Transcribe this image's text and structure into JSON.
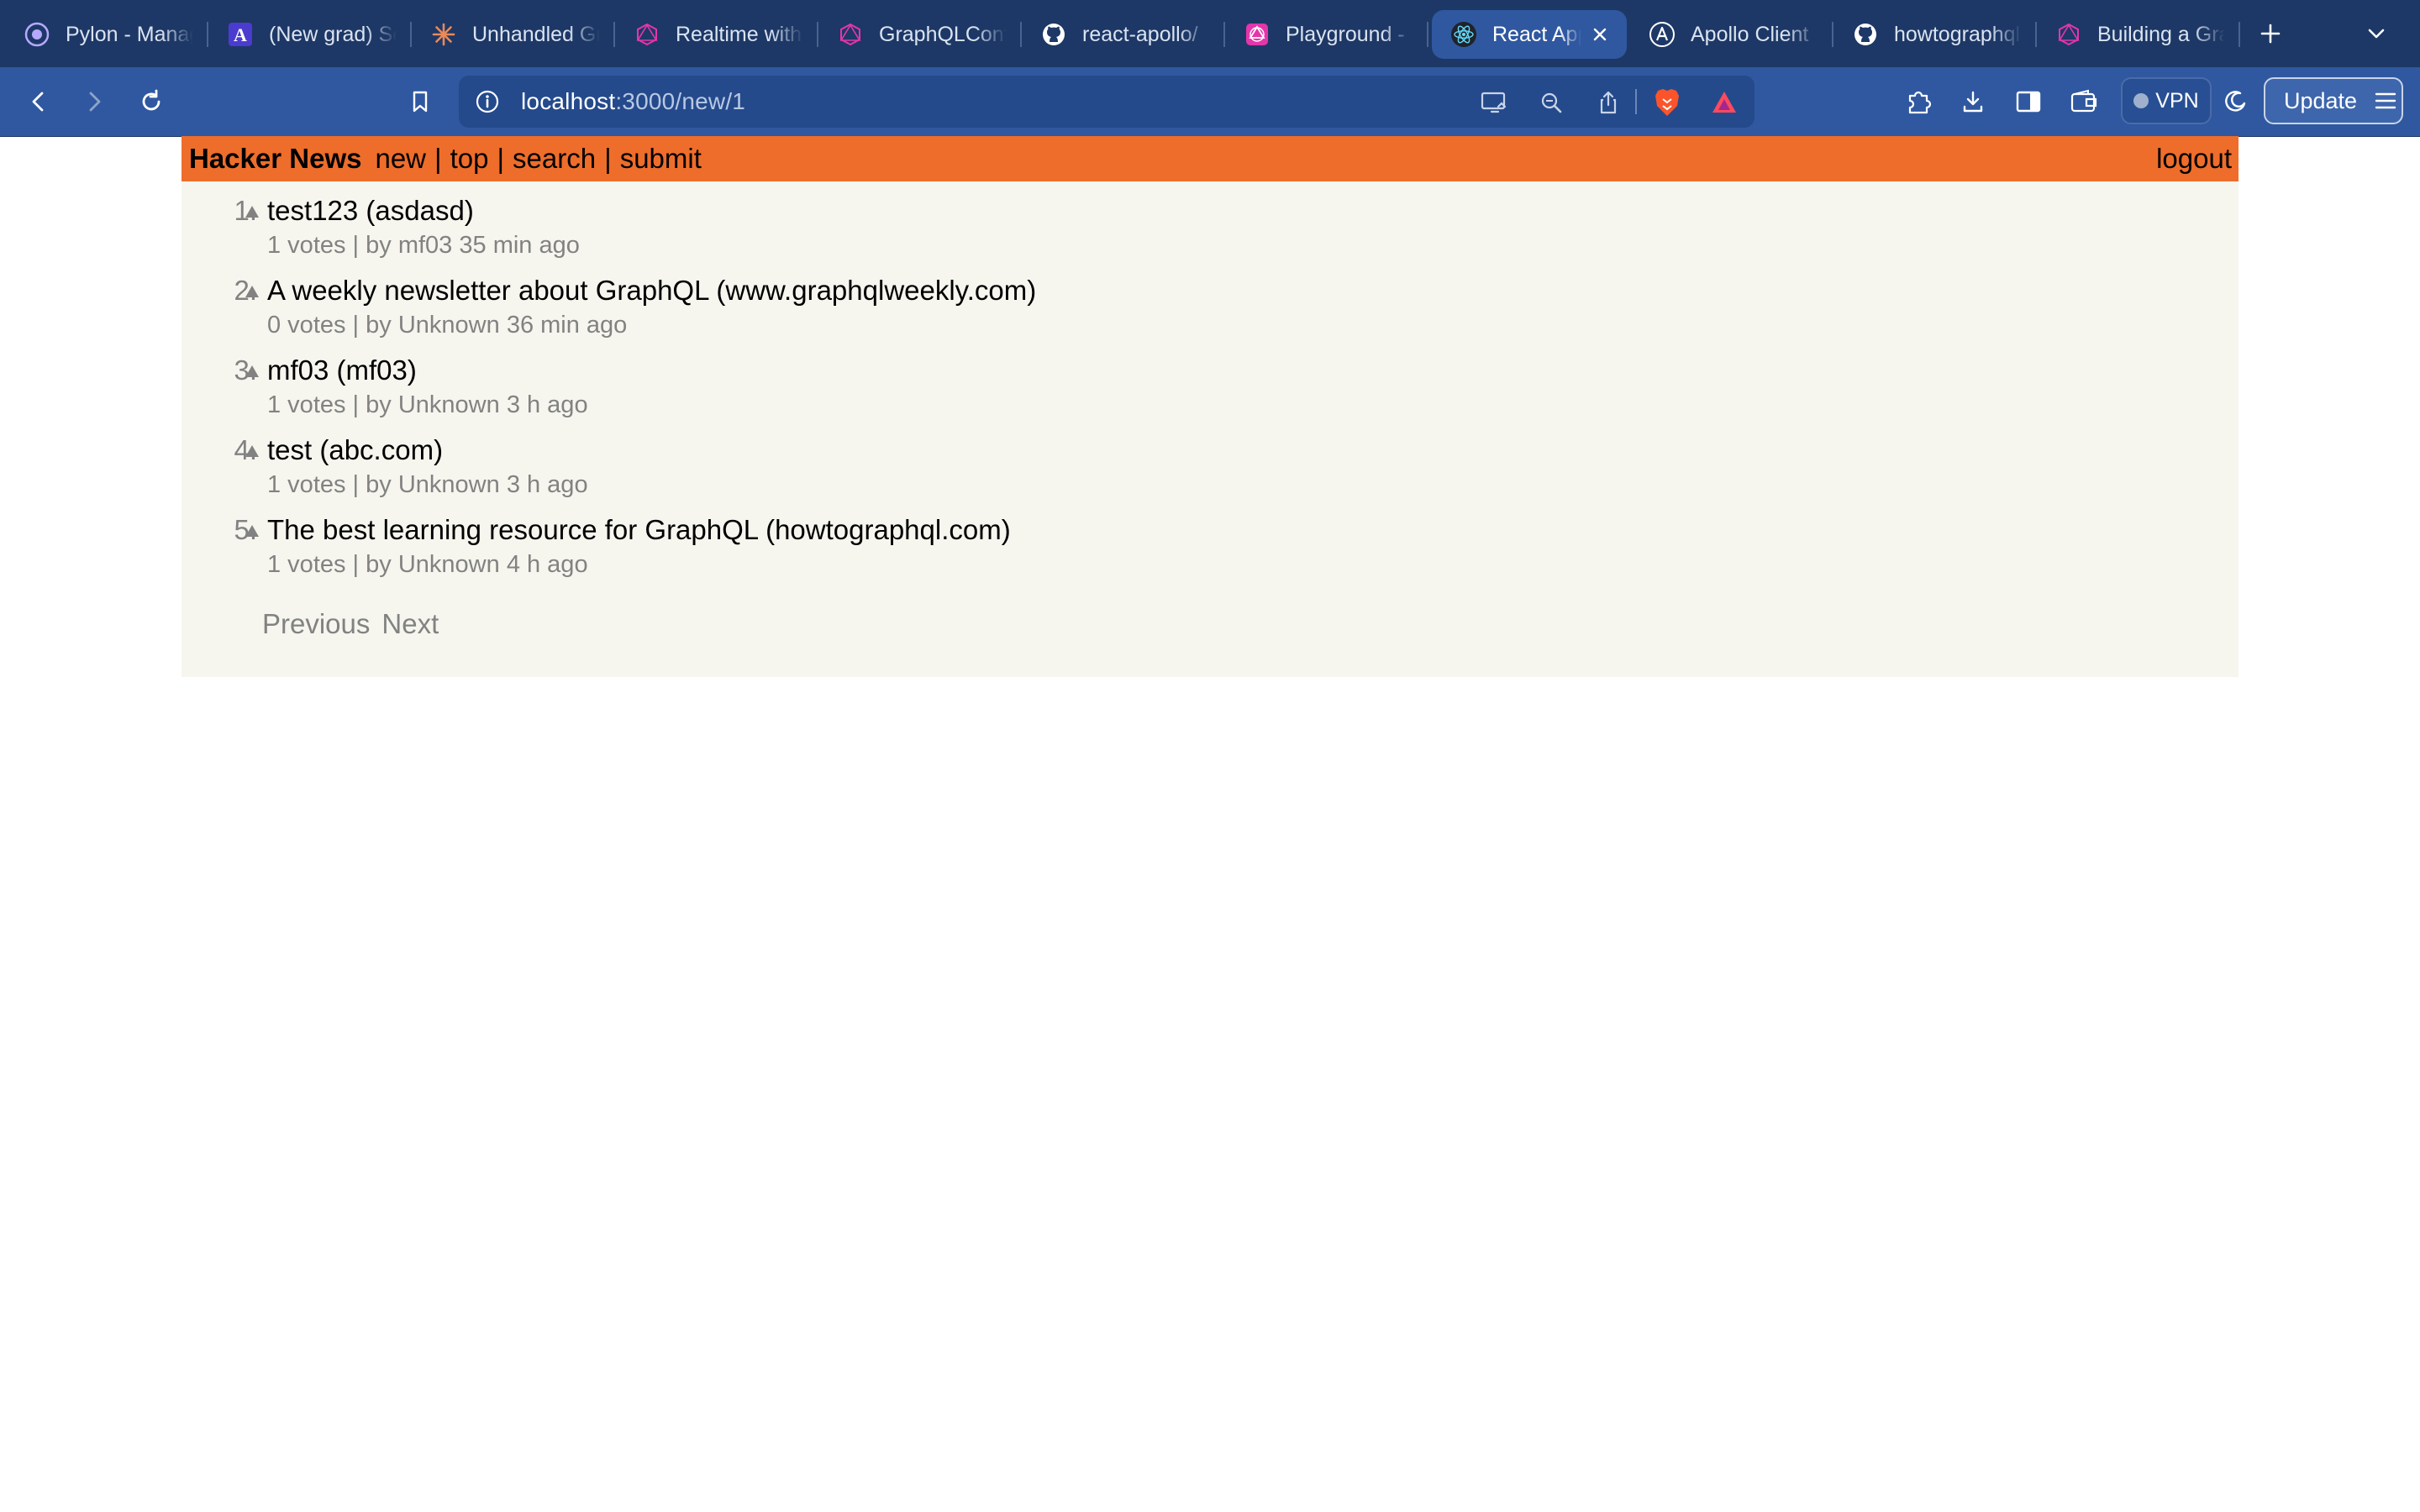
{
  "browser": {
    "tabs": [
      {
        "title": "Pylon - Manage",
        "icon": "pylon-icon",
        "active": false
      },
      {
        "title": "(New grad) Software",
        "icon": "letter-a-icon",
        "active": false
      },
      {
        "title": "Unhandled GraphQL",
        "icon": "burst-icon",
        "active": false
      },
      {
        "title": "Realtime with GraphQL",
        "icon": "graphql-icon",
        "active": false
      },
      {
        "title": "GraphQLConf",
        "icon": "graphql-icon",
        "active": false
      },
      {
        "title": "react-apollo/",
        "icon": "github-icon",
        "active": false
      },
      {
        "title": "Playground -",
        "icon": "graphql-playground-icon",
        "active": false
      },
      {
        "title": "React App",
        "icon": "react-icon",
        "active": true
      },
      {
        "title": "Apollo Client",
        "icon": "apollo-icon",
        "active": false
      },
      {
        "title": "howtographql",
        "icon": "github-icon",
        "active": false
      },
      {
        "title": "Building a GraphQL",
        "icon": "graphql-icon",
        "active": false
      }
    ],
    "url_host": "localhost",
    "url_path": ":3000/new/1",
    "vpn_label": "VPN",
    "update_label": "Update"
  },
  "header": {
    "brand": "Hacker News",
    "nav": [
      "new",
      "top",
      "search",
      "submit"
    ],
    "separator": "|",
    "logout": "logout"
  },
  "links": [
    {
      "rank": "1.",
      "title": "test123 (asdasd)",
      "votes": "1 votes",
      "by": "by mf03",
      "time": "35 min ago"
    },
    {
      "rank": "2.",
      "title": "A weekly newsletter about GraphQL (www.graphqlweekly.com)",
      "votes": "0 votes",
      "by": "by Unknown",
      "time": "36 min ago"
    },
    {
      "rank": "3.",
      "title": "mf03 (mf03)",
      "votes": "1 votes",
      "by": "by Unknown",
      "time": "3 h ago"
    },
    {
      "rank": "4.",
      "title": "test (abc.com)",
      "votes": "1 votes",
      "by": "by Unknown",
      "time": "3 h ago"
    },
    {
      "rank": "5.",
      "title": "The best learning resource for GraphQL (howtographql.com)",
      "votes": "1 votes",
      "by": "by Unknown",
      "time": "4 h ago"
    }
  ],
  "pager": {
    "previous": "Previous",
    "next": "Next"
  },
  "colors": {
    "hn_orange": "#ee6d2b",
    "page_bg": "#f6f6ef",
    "meta_gray": "#828282",
    "chrome_dark": "#1d3866",
    "chrome_blue": "#2f58a0"
  }
}
